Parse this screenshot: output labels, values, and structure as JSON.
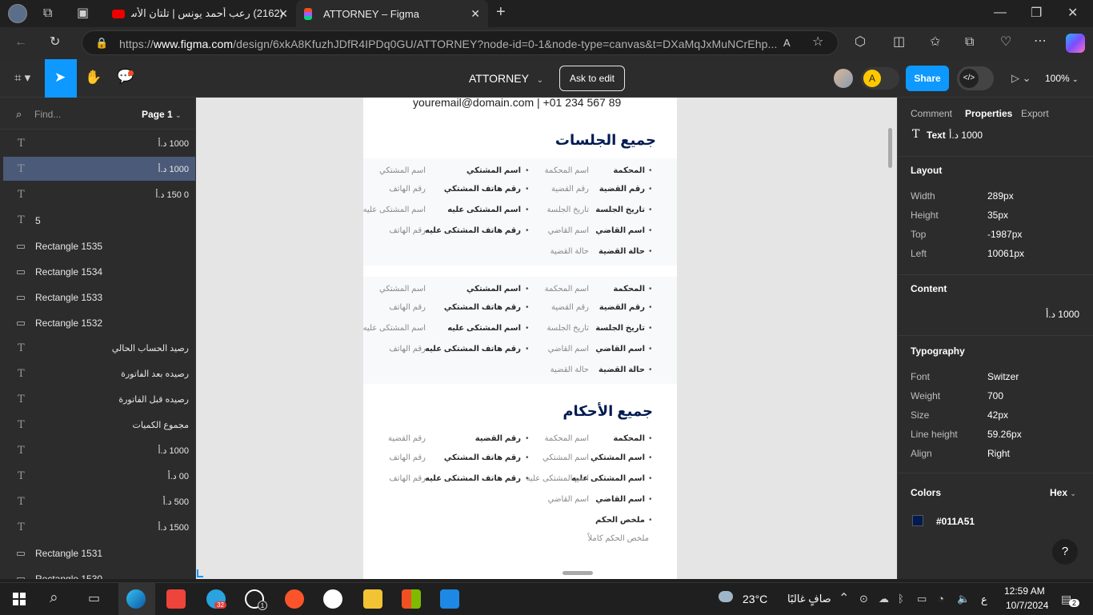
{
  "browser": {
    "tabs": [
      {
        "label": "(2162) رعب أحمد يونس | تلتان الأسو",
        "active": false
      },
      {
        "label": "ATTORNEY – Figma",
        "active": true
      }
    ],
    "new_tab": "+",
    "url_host": "www.figma.com",
    "url_prefix": "https://",
    "url_rest": "/design/6xkA8KfuzhJDfR4IPDq0GU/ATTORNEY?node-id=0-1&node-type=canvas&t=DXaMqJxMuNCrEhp..."
  },
  "figma_toolbar": {
    "file_name": "ATTORNEY",
    "ask_to_edit": "Ask to edit",
    "avatar_letter": "A",
    "share": "Share",
    "zoom": "100%"
  },
  "left_panel": {
    "search_placeholder": "Find...",
    "page": "Page 1",
    "layers": [
      {
        "type": "text",
        "name": "1000 د.أ",
        "rtl": true,
        "selected": false
      },
      {
        "type": "text",
        "name": "1000 د.أ",
        "rtl": true,
        "selected": true
      },
      {
        "type": "text",
        "name": "0 150 د.أ",
        "rtl": true,
        "selected": false
      },
      {
        "type": "text",
        "name": "5",
        "rtl": false,
        "selected": false
      },
      {
        "type": "rect",
        "name": "Rectangle 1535",
        "rtl": false,
        "selected": false
      },
      {
        "type": "rect",
        "name": "Rectangle 1534",
        "rtl": false,
        "selected": false
      },
      {
        "type": "rect",
        "name": "Rectangle 1533",
        "rtl": false,
        "selected": false
      },
      {
        "type": "rect",
        "name": "Rectangle 1532",
        "rtl": false,
        "selected": false
      },
      {
        "type": "text",
        "name": "رصيد الحساب الحالي",
        "rtl": true,
        "selected": false
      },
      {
        "type": "text",
        "name": "رصيده بعد الفاتورة",
        "rtl": true,
        "selected": false
      },
      {
        "type": "text",
        "name": "رصيده قبل الفاتورة",
        "rtl": true,
        "selected": false
      },
      {
        "type": "text",
        "name": "مجموع الكميات",
        "rtl": true,
        "selected": false
      },
      {
        "type": "text",
        "name": "1000 د.أ",
        "rtl": true,
        "selected": false
      },
      {
        "type": "text",
        "name": "00 د.أ",
        "rtl": true,
        "selected": false
      },
      {
        "type": "text",
        "name": "500 د.أ",
        "rtl": true,
        "selected": false
      },
      {
        "type": "text",
        "name": "1500 د.أ",
        "rtl": true,
        "selected": false
      },
      {
        "type": "rect",
        "name": "Rectangle 1531",
        "rtl": false,
        "selected": false
      },
      {
        "type": "rect",
        "name": "Rectangle 1530",
        "rtl": false,
        "selected": false
      }
    ]
  },
  "canvas": {
    "contact": "youremail@domain.com | +01 234 567 89",
    "sessions_heading": "جميع الجلسات",
    "rulings_heading": "جميع الأحكام",
    "session_rows": [
      {
        "l1": "المحكمة",
        "v1": "اسم المحكمة",
        "l2": "اسم المشتكي",
        "v2": "اسم المشتكي"
      },
      {
        "l1": "رقم القضية",
        "v1": "رقم القضية",
        "l2": "رقم هاتف المشتكي",
        "v2": "رقم الهاتف"
      },
      {
        "l1": "تاريخ الجلسة",
        "v1": "تاريخ الجلسة",
        "l2": "اسم المشتكى عليه",
        "v2": "اسم المشتكى عليه"
      },
      {
        "l1": "اسم القاضي",
        "v1": "اسم القاضي",
        "l2": "رقم هاتف المشتكى عليه",
        "v2": "رقم الهاتف"
      },
      {
        "l1": "حالة القضية",
        "v1": "حالة القضية",
        "l2": "",
        "v2": ""
      }
    ],
    "ruling_rows": [
      {
        "l1": "المحكمة",
        "v1": "اسم المحكمة",
        "l2": "رقم القضية",
        "v2": "رقم القضية"
      },
      {
        "l1": "اسم المشتكي",
        "v1": "اسم المشتكي",
        "l2": "رقم هاتف المشتكي",
        "v2": "رقم الهاتف"
      },
      {
        "l1": "اسم المشتكى عليه",
        "v1": "اسم المشتكى عليه",
        "l2": "رقم هاتف المشتكى عليه",
        "v2": "رقم الهاتف"
      },
      {
        "l1": "اسم القاضي",
        "v1": "اسم القاضي",
        "l2": "",
        "v2": ""
      },
      {
        "l1": "ملخص الحكم",
        "v1": "",
        "l2": "",
        "v2": ""
      }
    ],
    "ruling_summary": "ملخص الحكم كاملاً"
  },
  "right_panel": {
    "tabs": [
      "Comment",
      "Properties",
      "Export"
    ],
    "active_tab": "Properties",
    "selection_type": "Text",
    "selection_name": "1000 د.أ",
    "layout_title": "Layout",
    "layout": [
      {
        "k": "Width",
        "v": "289px"
      },
      {
        "k": "Height",
        "v": "35px"
      },
      {
        "k": "Top",
        "v": "-1987px"
      },
      {
        "k": "Left",
        "v": "10061px"
      }
    ],
    "content_title": "Content",
    "content_value": "1000 د.أ",
    "typography_title": "Typography",
    "typography": [
      {
        "k": "Font",
        "v": "Switzer"
      },
      {
        "k": "Weight",
        "v": "700"
      },
      {
        "k": "Size",
        "v": "42px"
      },
      {
        "k": "Line height",
        "v": "59.26px"
      },
      {
        "k": "Align",
        "v": "Right"
      }
    ],
    "colors_title": "Colors",
    "colors_format": "Hex",
    "color_hex": "#011A51",
    "help": "?"
  },
  "taskbar": {
    "weather_temp": "23°C",
    "weather_text": "صافٍ غالبًا",
    "time": "12:59 AM",
    "date": "10/7/2024",
    "telegram_badge": "32",
    "whatsapp_badge": "1",
    "notif_badge": "2",
    "lang": "ع"
  },
  "colors": {
    "accent": "#0d99ff",
    "heading": "#011A51",
    "selected_row": "#4c5a7a"
  }
}
